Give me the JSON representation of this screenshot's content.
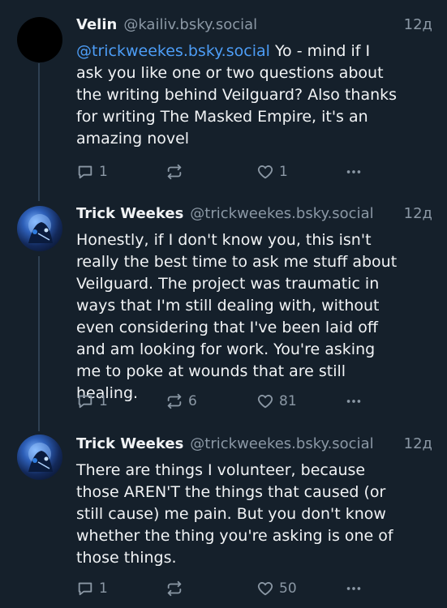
{
  "posts": [
    {
      "author_name": "Velin",
      "handle": "@kailiv.bsky.social",
      "time": "12д",
      "mention": "@trickweekes.bsky.social",
      "text": " Yo - mind if I ask you like one or two questions about the writing behind Veilguard? Also thanks for writing The Masked Empire, it's an amazing novel",
      "replies": "1",
      "reposts": "",
      "likes": "1"
    },
    {
      "author_name": "Trick Weekes",
      "handle": "@trickweekes.bsky.social",
      "time": "12д",
      "text": "Honestly, if I don't know you, this isn't really the best time to ask me stuff about Veilguard. The project was traumatic in ways that I'm still dealing with, without even considering that I've been laid off and am looking for work. You're asking me to poke at wounds that are still healing.",
      "replies": "1",
      "reposts": "6",
      "likes": "81"
    },
    {
      "author_name": "Trick Weekes",
      "handle": "@trickweekes.bsky.social",
      "time": "12д",
      "text": "There are things I volunteer, because those AREN'T the things that caused (or still cause) me pain. But you don't know whether the thing you're asking is one of those things.",
      "replies": "1",
      "reposts": "",
      "likes": "50"
    }
  ],
  "icons": {
    "reply": "reply-icon",
    "repost": "repost-icon",
    "like": "heart-icon",
    "more": "more-icon"
  },
  "colors": {
    "background": "#15202b",
    "text": "#f1f3f5",
    "muted": "#8b98a5",
    "link": "#4d9df6"
  }
}
